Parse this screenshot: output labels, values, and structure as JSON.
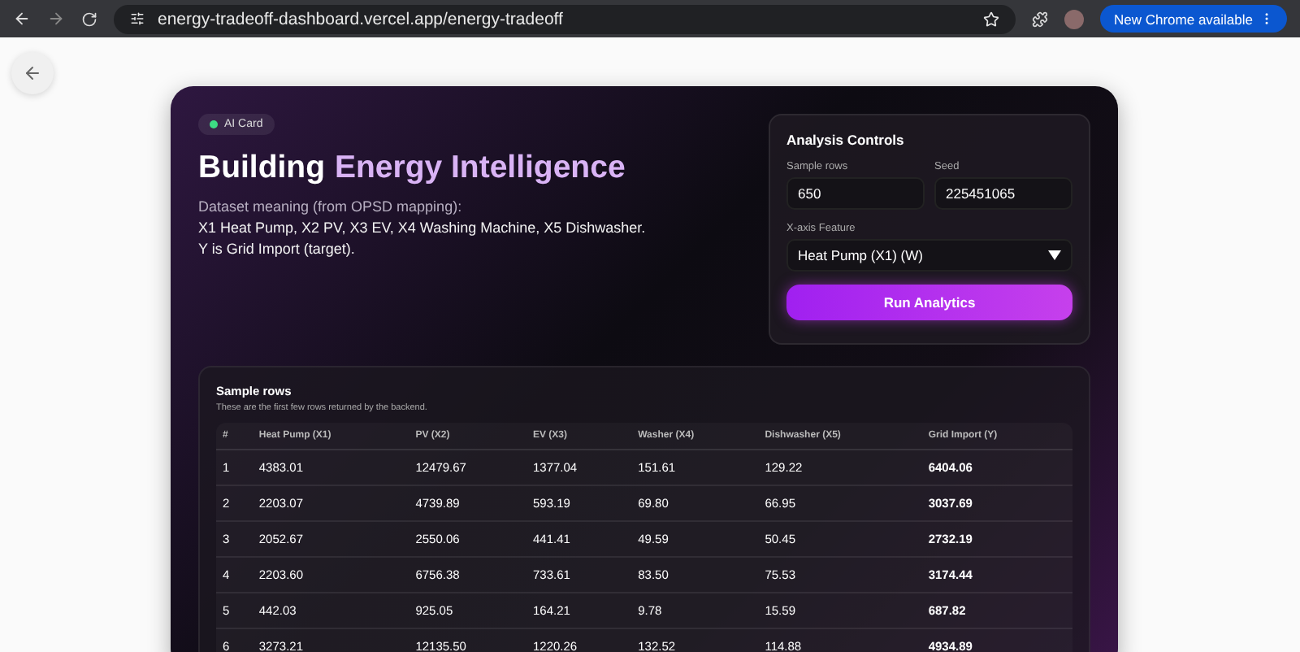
{
  "browser": {
    "url": "energy-tradeoff-dashboard.vercel.app/energy-tradeoff",
    "update_button": "New Chrome available"
  },
  "card": {
    "badge": "AI Card",
    "title": [
      {
        "text": "Building",
        "highlight": false
      },
      {
        "text": "Energy Intelligence",
        "highlight": true
      }
    ],
    "description_intro": "Dataset meaning (from OPSD mapping):",
    "description_lines": [
      "X1 Heat Pump, X2 PV, X3 EV, X4 Washing Machine, X5 Dishwasher.",
      "Y is Grid Import (target)."
    ]
  },
  "controls": {
    "title": "Analysis Controls",
    "fields": [
      {
        "label": "Sample rows",
        "value": "650"
      },
      {
        "label": "Seed",
        "value": "225451065"
      }
    ],
    "select": {
      "label": "X-axis Feature",
      "value": "Heat Pump (X1) (W)"
    },
    "button": "Run Analytics"
  },
  "table": {
    "title": "Sample rows",
    "subtitle": "These are the first few rows returned by the backend.",
    "columns": [
      {
        "label": "#",
        "emphasis": false
      },
      {
        "label": "Heat Pump (X1)",
        "emphasis": false
      },
      {
        "label": "PV (X2)",
        "emphasis": false
      },
      {
        "label": "EV (X3)",
        "emphasis": false
      },
      {
        "label": "Washer (X4)",
        "emphasis": false
      },
      {
        "label": "Dishwasher (X5)",
        "emphasis": false
      },
      {
        "label": "Grid Import (Y)",
        "emphasis": true
      }
    ],
    "rows": [
      [
        "1",
        "4383.01",
        "12479.67",
        "1377.04",
        "151.61",
        "129.22",
        "6404.06"
      ],
      [
        "2",
        "2203.07",
        "4739.89",
        "593.19",
        "69.80",
        "66.95",
        "3037.69"
      ],
      [
        "3",
        "2052.67",
        "2550.06",
        "441.41",
        "49.59",
        "50.45",
        "2732.19"
      ],
      [
        "4",
        "2203.60",
        "6756.38",
        "733.61",
        "83.50",
        "75.53",
        "3174.44"
      ],
      [
        "5",
        "442.03",
        "925.05",
        "164.21",
        "9.78",
        "15.59",
        "687.82"
      ],
      [
        "6",
        "3273.21",
        "12135.50",
        "1220.26",
        "132.52",
        "114.88",
        "4934.89"
      ]
    ]
  }
}
